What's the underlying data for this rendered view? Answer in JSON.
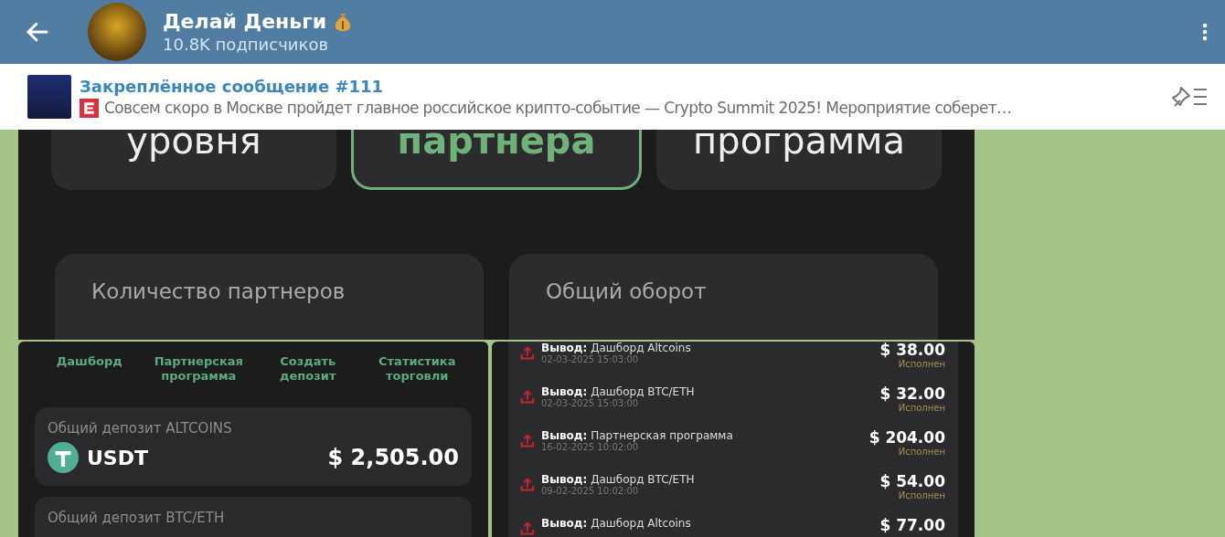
{
  "header": {
    "title": "Делай Деньги",
    "subtitle": "10.8K подписчиков"
  },
  "pinned": {
    "title": "Закреплённое сообщение #111",
    "text": "Совсем скоро в Москве пройдет главное российское крипто-событие — Crypto Summit 2025!  Мероприятие соберет…"
  },
  "partner_screen": {
    "tabs": [
      {
        "label": "уровня",
        "selected": false
      },
      {
        "label": "партнера",
        "selected": true
      },
      {
        "label": "программа",
        "selected": false
      }
    ],
    "stats": [
      "Количество партнеров",
      "Общий оборот"
    ]
  },
  "dashboard_screen": {
    "nav": [
      "Дашборд",
      "Партнерская программа",
      "Создать депозит",
      "Статистика торговли"
    ],
    "deposits": [
      {
        "label": "Общий депозит ALTCOINS",
        "currency": "USDT",
        "amount": "$ 2,505.00"
      },
      {
        "label": "Общий депозит BTC/ETH"
      }
    ]
  },
  "history_screen": {
    "transactions": [
      {
        "type": "Вывод:",
        "name": "Дашборд Altcoins",
        "date": "02-03-2025 15:03:00",
        "amount": "$ 38.00",
        "status": "Исполнен"
      },
      {
        "type": "Вывод:",
        "name": "Дашборд BTC/ETH",
        "date": "02-03-2025 15:03:00",
        "amount": "$ 32.00",
        "status": "Исполнен"
      },
      {
        "type": "Вывод:",
        "name": "Партнерская программа",
        "date": "16-02-2025 10:02:00",
        "amount": "$ 204.00",
        "status": "Исполнен"
      },
      {
        "type": "Вывод:",
        "name": "Дашборд BTC/ETH",
        "date": "09-02-2025 10:02:00",
        "amount": "$ 54.00",
        "status": "Исполнен"
      },
      {
        "type": "Вывод:",
        "name": "Дашборд Altcoins",
        "amount": "$ 77.00"
      }
    ]
  }
}
